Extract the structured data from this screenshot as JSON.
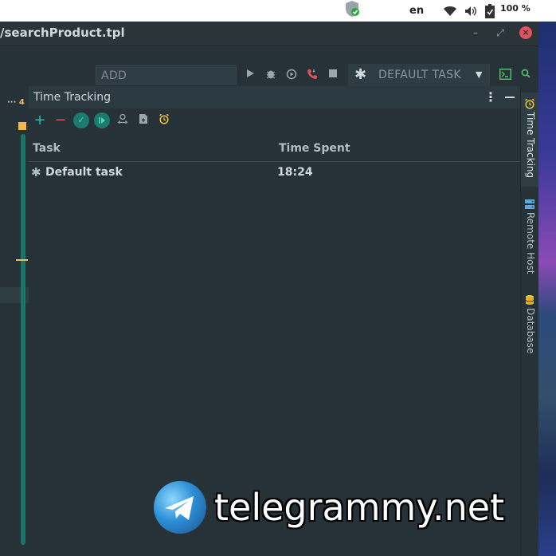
{
  "system": {
    "keyboard_layout": "en",
    "battery": "100 %",
    "icons": [
      "shield-check-icon",
      "wifi-icon",
      "volume-icon",
      "battery-icon"
    ]
  },
  "window": {
    "title": "/searchProduct.tpl",
    "minimize": "–",
    "restore": "⤢",
    "close": "×"
  },
  "toolbar": {
    "add_configuration": "ADD CONFIGURATION...",
    "task_selector": "DEFAULT TASK",
    "icons": [
      "run-icon",
      "debug-icon",
      "coverage-icon",
      "phone-icon",
      "stop-icon",
      "terminal-icon",
      "search-icon"
    ]
  },
  "gutter": {
    "dots": "··· 4"
  },
  "panel": {
    "title": "Time Tracking",
    "toolbar_icons": [
      "add-icon",
      "remove-icon",
      "check-icon",
      "play-icon",
      "user-switch-icon",
      "export-icon",
      "alarm-icon"
    ],
    "table": {
      "columns": [
        "Task",
        "Time Spent"
      ],
      "rows": [
        {
          "task": "Default task",
          "time": "18:24"
        }
      ]
    }
  },
  "right_sidebar": {
    "tabs": [
      "Time Tracking",
      "Remote Host",
      "Database"
    ]
  },
  "watermark": {
    "text": "telegrammy.net"
  },
  "colors": {
    "accent": "#1c7a6e",
    "background": "#263238",
    "close_red": "#e0525c",
    "alarm_yellow": "#f3c93a"
  }
}
